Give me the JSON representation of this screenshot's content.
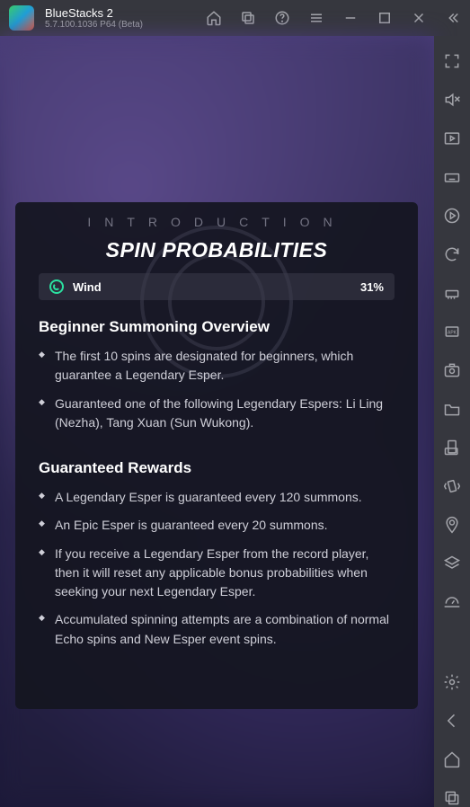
{
  "titlebar": {
    "app_name": "BlueStacks 2",
    "version": "5.7.100.1036  P64 (Beta)"
  },
  "modal": {
    "eyebrow": "INTRODUCTION",
    "title": "SPIN PROBABILITIES",
    "stat": {
      "element": "Wind",
      "percent": "31%"
    },
    "section1_title": "Beginner Summoning Overview",
    "section2_title": "Guaranteed Rewards",
    "section1": [
      "The first 10 spins are designated for beginners, which guarantee a Legendary Esper.",
      "Guaranteed one of the following Legendary Espers: Li Ling (Nezha), Tang Xuan (Sun Wukong)."
    ],
    "section2": [
      "A Legendary Esper is guaranteed every 120 summons.",
      "An Epic Esper is guaranteed every 20 summons.",
      "If you receive a Legendary Esper from the record player, then it will reset any applicable bonus probabilities when seeking your next Legendary Esper.",
      "Accumulated spinning attempts are a combination of normal Echo spins and New Esper event spins."
    ]
  }
}
